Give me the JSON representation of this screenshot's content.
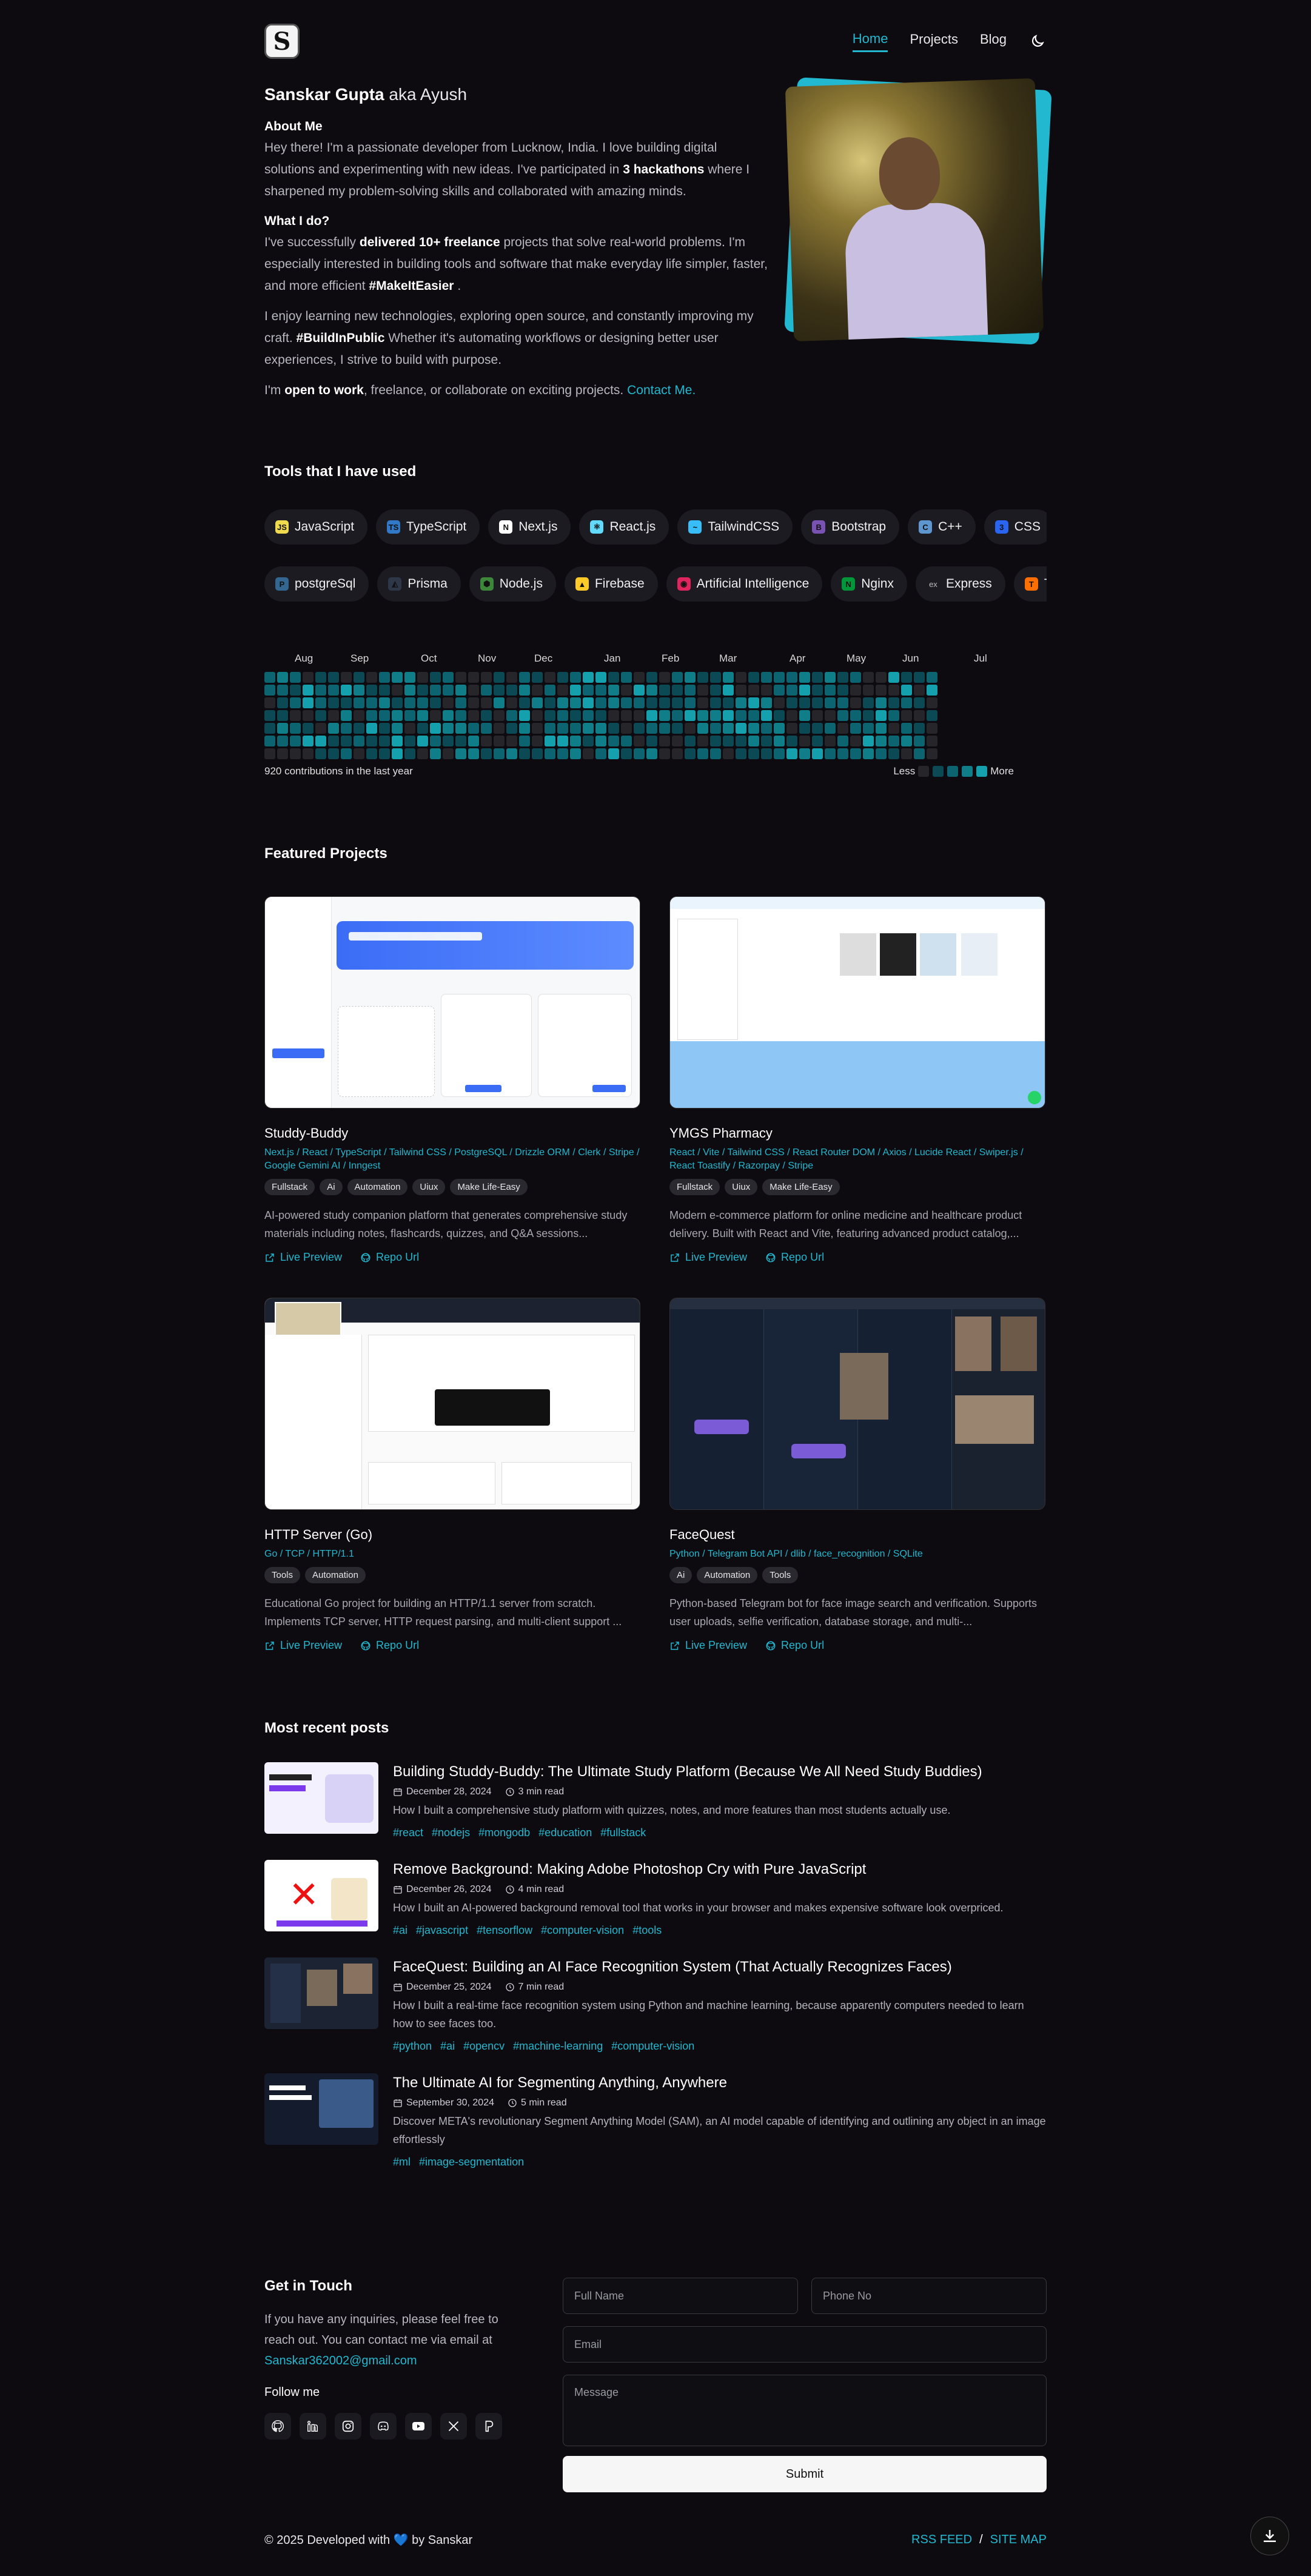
{
  "nav": {
    "logo": "S",
    "links": [
      {
        "label": "Home",
        "active": true
      },
      {
        "label": "Projects",
        "active": false
      },
      {
        "label": "Blog",
        "active": false
      }
    ]
  },
  "hero": {
    "name": "Sanskar Gupta",
    "aka": "aka Ayush",
    "about_heading": "About Me",
    "about_p1": "Hey there! I'm a passionate developer from Lucknow, India. I love building digital solutions and experimenting with new ideas. I've participated in",
    "about_p1_bold": "3 hackathons",
    "about_p1_end": "where I sharpened my problem-solving skills and collaborated with amazing minds.",
    "what_heading": "What I do?",
    "what_p1_start": "I've successfully",
    "what_p1_bold": "delivered 10+ freelance",
    "what_p1_mid": "projects that solve real-world problems. I'm especially interested in building tools and software that make everyday life simpler, faster, and more efficient",
    "what_p1_tag": "#MakeItEasier",
    "what_p1_end": ".",
    "p2_start": "I enjoy learning new technologies, exploring open source, and constantly improving my craft.",
    "p2_tag": "#BuildInPublic",
    "p2_end": "Whether it's automating workflows or designing better user experiences, I strive to build with purpose.",
    "p3_start": "I'm",
    "p3_bold": "open to work",
    "p3_mid": ", freelance, or collaborate on exciting projects.",
    "p3_link": "Contact Me."
  },
  "tools": {
    "title": "Tools that I have used",
    "row1": [
      {
        "label": "JavaScript",
        "icon": "js-icon",
        "color": "#f0db4f",
        "glyph": "JS"
      },
      {
        "label": "TypeScript",
        "icon": "ts-icon",
        "color": "#3178c6",
        "glyph": "TS"
      },
      {
        "label": "Next.js",
        "icon": "nextjs-icon",
        "color": "#ffffff",
        "glyph": "N"
      },
      {
        "label": "React.js",
        "icon": "react-icon",
        "color": "#61dafb",
        "glyph": "⚛"
      },
      {
        "label": "TailwindCSS",
        "icon": "tailwind-icon",
        "color": "#38bdf8",
        "glyph": "~"
      },
      {
        "label": "Bootstrap",
        "icon": "bootstrap-icon",
        "color": "#7952b3",
        "glyph": "B"
      },
      {
        "label": "C++",
        "icon": "cpp-icon",
        "color": "#5e97d0",
        "glyph": "C"
      },
      {
        "label": "CSS",
        "icon": "css-icon",
        "color": "#2965f1",
        "glyph": "3"
      },
      {
        "label": "",
        "icon": "python-icon",
        "color": "#ffd43b",
        "glyph": "P"
      }
    ],
    "row2": [
      {
        "label": "postgreSql",
        "icon": "postgres-icon",
        "color": "#336791",
        "glyph": "P"
      },
      {
        "label": "Prisma",
        "icon": "prisma-icon",
        "color": "#2d3748",
        "glyph": "◭"
      },
      {
        "label": "Node.js",
        "icon": "nodejs-icon",
        "color": "#3c873a",
        "glyph": "⬢"
      },
      {
        "label": "Firebase",
        "icon": "firebase-icon",
        "color": "#ffca28",
        "glyph": "▲"
      },
      {
        "label": "Artificial Intelligence",
        "icon": "ai-icon",
        "color": "#e0245e",
        "glyph": "◉"
      },
      {
        "label": "Nginx",
        "icon": "nginx-icon",
        "color": "#009639",
        "glyph": "N"
      },
      {
        "label": "Express",
        "icon": "express-icon",
        "color": "#1c1b21",
        "glyph": "ex"
      },
      {
        "label": "Tenso",
        "icon": "tensorflow-icon",
        "color": "#ff6f00",
        "glyph": "T"
      }
    ]
  },
  "contributions": {
    "months": [
      "Aug",
      "Sep",
      "Oct",
      "Nov",
      "Dec",
      "Jan",
      "Feb",
      "Mar",
      "Apr",
      "May",
      "Jun",
      "Jul"
    ],
    "total_label": "920 contributions in the last year",
    "less": "Less",
    "more": "More"
  },
  "projects": {
    "title": "Featured Projects",
    "items": [
      {
        "title": "Studdy-Buddy",
        "tech": "Next.js / React / TypeScript / Tailwind CSS / PostgreSQL / Drizzle ORM / Clerk / Stripe / Google Gemini AI / Inngest",
        "tags": [
          "Fullstack",
          "Ai",
          "Automation",
          "Uiux",
          "Make Life-Easy"
        ],
        "desc": "AI-powered study companion platform that generates comprehensive study materials including notes, flashcards, quizzes, and Q&A sessions...",
        "live": "Live Preview",
        "repo": "Repo Url",
        "mock": "studdy"
      },
      {
        "title": "YMGS Pharmacy",
        "tech": "React / Vite / Tailwind CSS / React Router DOM / Axios / Lucide React / Swiper.js / React Toastify / Razorpay / Stripe",
        "tags": [
          "Fullstack",
          "Uiux",
          "Make Life-Easy"
        ],
        "desc": "Modern e-commerce platform for online medicine and healthcare product delivery. Built with React and Vite, featuring advanced product catalog,...",
        "live": "Live Preview",
        "repo": "Repo Url",
        "mock": "pharmacy"
      },
      {
        "title": "HTTP Server (Go)",
        "tech": "Go / TCP / HTTP/1.1",
        "tags": [
          "Tools",
          "Automation"
        ],
        "desc": "Educational Go project for building an HTTP/1.1 server from scratch. Implements TCP server, HTTP request parsing, and multi-client support ...",
        "live": "Live Preview",
        "repo": "Repo Url",
        "mock": "http"
      },
      {
        "title": "FaceQuest",
        "tech": "Python / Telegram Bot API / dlib / face_recognition / SQLite",
        "tags": [
          "Ai",
          "Automation",
          "Tools"
        ],
        "desc": "Python-based Telegram bot for face image search and verification. Supports user uploads, selfie verification, database storage, and multi-...",
        "live": "Live Preview",
        "repo": "Repo Url",
        "mock": "face"
      }
    ]
  },
  "posts": {
    "title": "Most recent posts",
    "items": [
      {
        "title": "Building Studdy-Buddy: The Ultimate Study Platform (Because We All Need Study Buddies)",
        "date": "December 28, 2024",
        "read": "3 min read",
        "desc": "How I built a comprehensive study platform with quizzes, notes, and more features than most students actually use.",
        "tags": [
          "#react",
          "#nodejs",
          "#mongodb",
          "#education",
          "#fullstack"
        ],
        "thumb": "study"
      },
      {
        "title": "Remove Background: Making Adobe Photoshop Cry with Pure JavaScript",
        "date": "December 26, 2024",
        "read": "4 min read",
        "desc": "How I built an AI-powered background removal tool that works in your browser and makes expensive software look overpriced.",
        "tags": [
          "#ai",
          "#javascript",
          "#tensorflow",
          "#computer-vision",
          "#tools"
        ],
        "thumb": "bg"
      },
      {
        "title": "FaceQuest: Building an AI Face Recognition System (That Actually Recognizes Faces)",
        "date": "December 25, 2024",
        "read": "7 min read",
        "desc": "How I built a real-time face recognition system using Python and machine learning, because apparently computers needed to learn how to see faces too.",
        "tags": [
          "#python",
          "#ai",
          "#opencv",
          "#machine-learning",
          "#computer-vision"
        ],
        "thumb": "face"
      },
      {
        "title": "The Ultimate AI for Segmenting Anything, Anywhere",
        "date": "September 30, 2024",
        "read": "5 min read",
        "desc": "Discover META's revolutionary Segment Anything Model (SAM), an AI model capable of identifying and outlining any object in an image effortlessly",
        "tags": [
          "#ml",
          "#image-segmentation"
        ],
        "thumb": "sam"
      }
    ]
  },
  "contact": {
    "title": "Get in Touch",
    "text": "If you have any inquiries, please feel free to reach out. You can contact me via email at",
    "email": "Sanskar362002@gmail.com",
    "follow": "Follow me",
    "fields": {
      "name": "Full Name",
      "phone": "Phone No",
      "email": "Email",
      "message": "Message"
    },
    "submit": "Submit"
  },
  "footer": {
    "copy_start": "© 2025 Developed with",
    "copy_end": "by Sanskar",
    "rss": "RSS FEED",
    "sep": "/",
    "sitemap": "SITE MAP"
  },
  "colors": {
    "accent": "#22b8cf",
    "background": "#0d0b10"
  }
}
